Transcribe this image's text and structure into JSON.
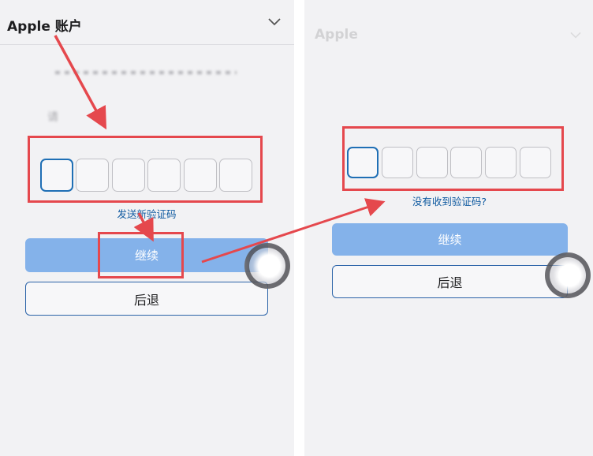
{
  "left": {
    "header": {
      "title": "Apple 账户",
      "icon": "chevron-down-icon"
    },
    "code_boxes": 6,
    "link": "发送新验证码",
    "continue_label": "继续",
    "back_label": "后退"
  },
  "right": {
    "header": {
      "title": "Apple"
    },
    "code_boxes": 6,
    "link": "没有收到验证码?",
    "continue_label": "继续",
    "back_label": "后退"
  },
  "colors": {
    "accent": "#84b2ea",
    "annotation": "#e5484d",
    "link": "#0f5aa0"
  }
}
